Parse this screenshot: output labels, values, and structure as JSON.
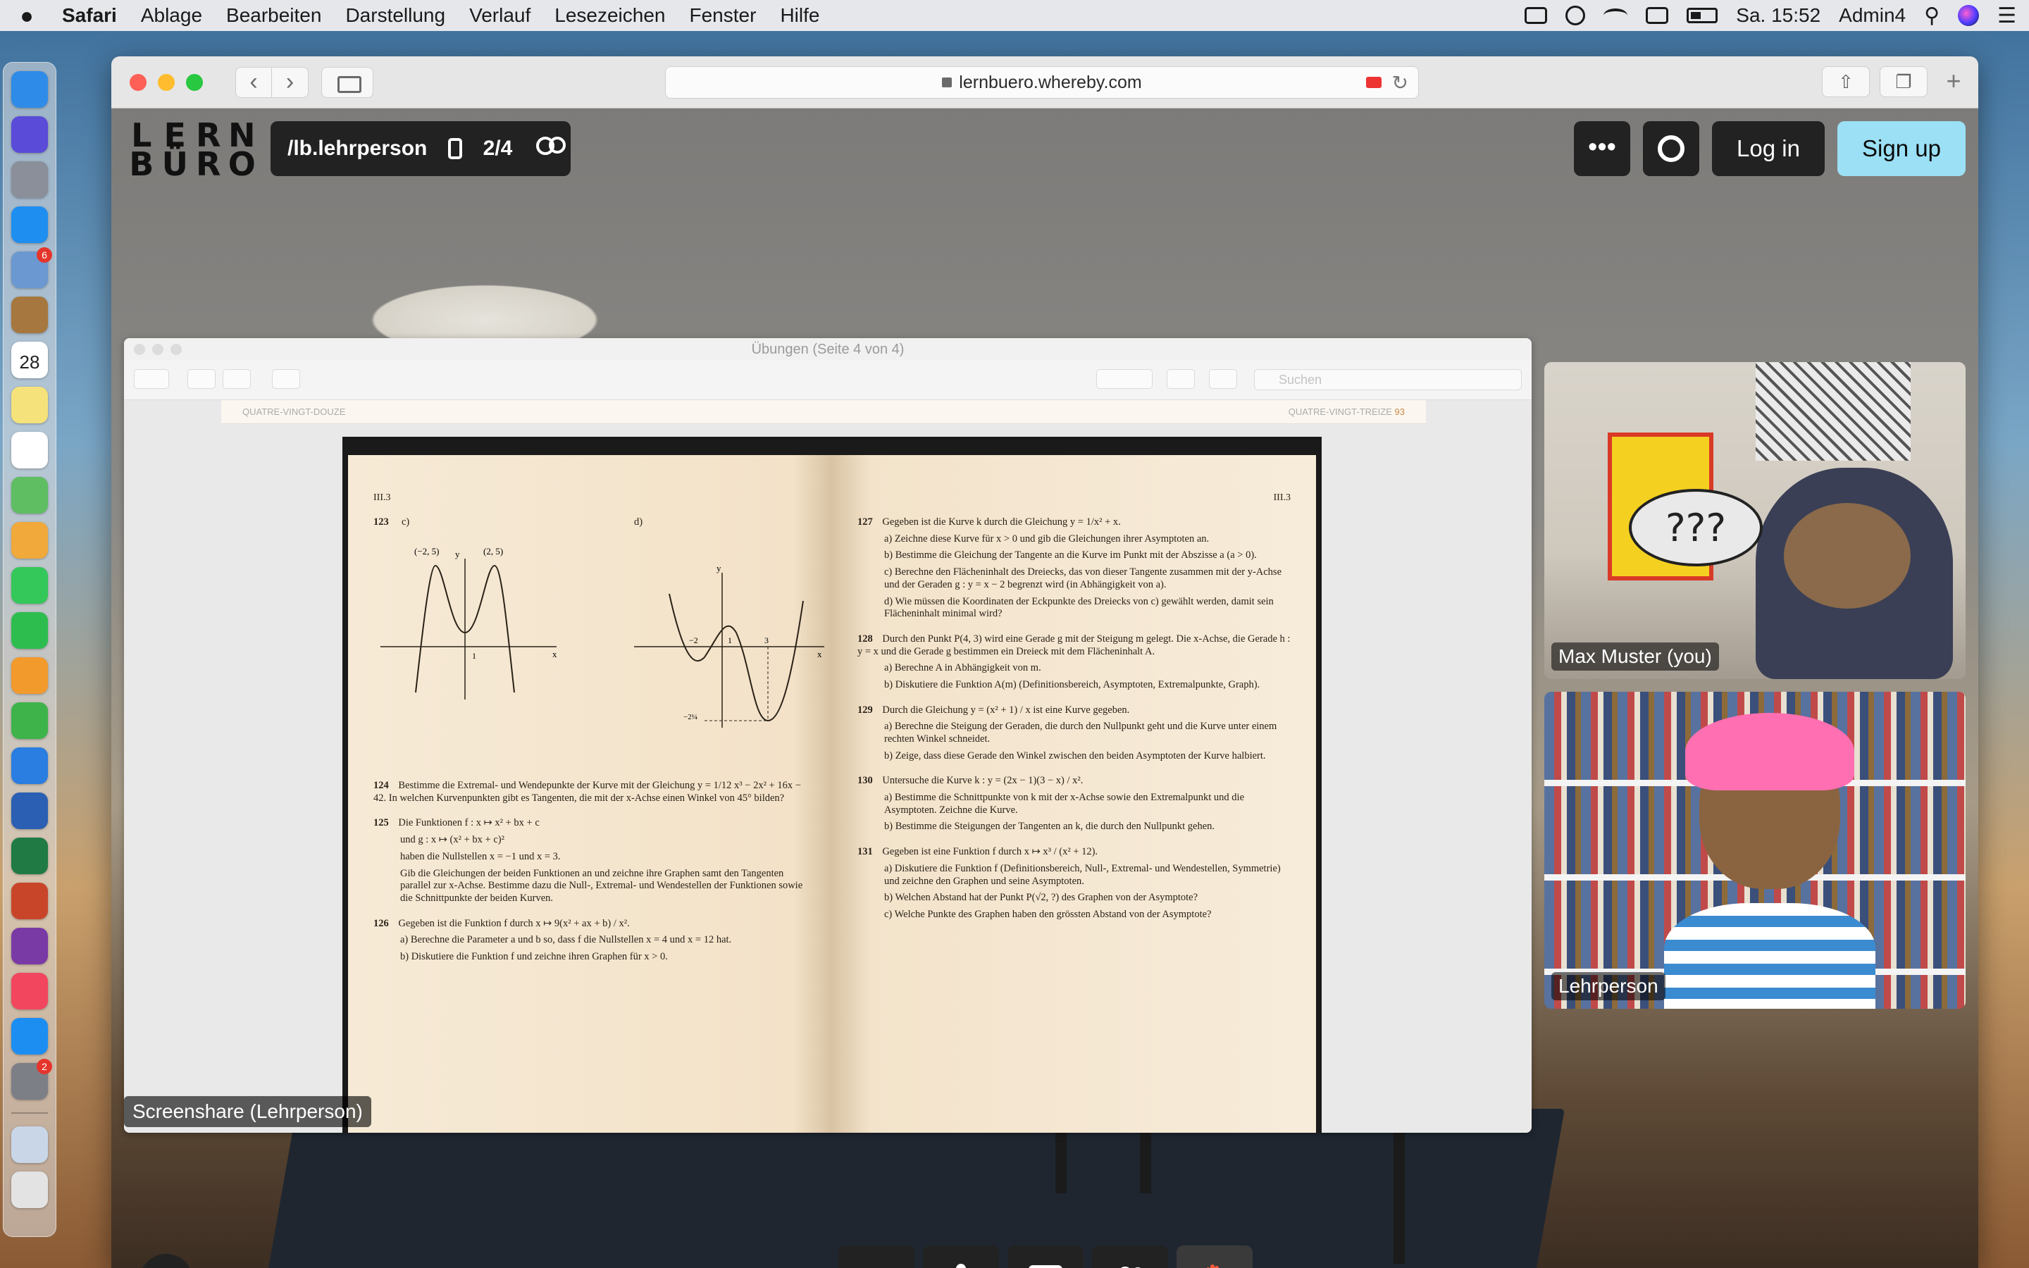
{
  "menubar": {
    "apple": "",
    "items": [
      "Safari",
      "Ablage",
      "Bearbeiten",
      "Darstellung",
      "Verlauf",
      "Lesezeichen",
      "Fenster",
      "Hilfe"
    ],
    "clock": "Sa. 15:52",
    "user": "Admin4"
  },
  "dock": {
    "apps": [
      {
        "icon": "finder-icon",
        "color": "#2e8ce8"
      },
      {
        "icon": "siri-icon",
        "color": "#5a4bd8"
      },
      {
        "icon": "launchpad-icon",
        "color": "#8b8f99"
      },
      {
        "icon": "safari-icon",
        "color": "#1e8ef0"
      },
      {
        "icon": "mail-icon",
        "color": "#6b98d0",
        "badge": "6"
      },
      {
        "icon": "notes-brown-icon",
        "color": "#a6773e"
      },
      {
        "icon": "calendar-icon",
        "color": "#ffffff",
        "text": "28"
      },
      {
        "icon": "notes-icon",
        "color": "#f5e27a"
      },
      {
        "icon": "reminders-icon",
        "color": "#ffffff"
      },
      {
        "icon": "maps-icon",
        "color": "#5fbd62"
      },
      {
        "icon": "photos-icon",
        "color": "#f0a93a"
      },
      {
        "icon": "messages-icon",
        "color": "#34c759"
      },
      {
        "icon": "facetime-icon",
        "color": "#2dbd4f"
      },
      {
        "icon": "pages-icon",
        "color": "#f29a2c"
      },
      {
        "icon": "numbers-icon",
        "color": "#3db34a"
      },
      {
        "icon": "keynote-icon",
        "color": "#2a7de1"
      },
      {
        "icon": "word-icon",
        "color": "#2b5fb3"
      },
      {
        "icon": "excel-icon",
        "color": "#1f7a44"
      },
      {
        "icon": "powerpoint-icon",
        "color": "#c9452a"
      },
      {
        "icon": "onenote-icon",
        "color": "#7a3aa6"
      },
      {
        "icon": "music-icon",
        "color": "#f2465e"
      },
      {
        "icon": "appstore-icon",
        "color": "#1c8ef2"
      },
      {
        "icon": "system-preferences-icon",
        "color": "#7d7f86",
        "badge": "2"
      },
      {
        "icon": "preview-icon",
        "color": "#c8d6e8"
      },
      {
        "icon": "trash-icon",
        "color": "#e3e3e3"
      }
    ]
  },
  "browser": {
    "url": "lernbuero.whereby.com"
  },
  "whereby": {
    "logo_letters": [
      "L",
      "E",
      "R",
      "N",
      "B",
      "Ü",
      "R",
      "O"
    ],
    "room_name": "/lb.lehrperson",
    "participant_count": "2/4",
    "more_label": "•••",
    "login_label": "Log in",
    "signup_label": "Sign up",
    "help_label": "?",
    "screenshare_label": "Screenshare (Lehrperson)",
    "participants": [
      {
        "name": "Max Muster (you)",
        "speech": "???"
      },
      {
        "name": "Lehrperson"
      }
    ]
  },
  "preview": {
    "title": "Übungen (Seite 4 von 4)",
    "search_placeholder": "Suchen",
    "prev_page_left": "QUATRE-VINGT-DOUZE",
    "prev_page_right": "QUATRE-VINGT-TREIZE",
    "prev_page_num": "93"
  },
  "book": {
    "left": {
      "section": "III.3",
      "p123": {
        "num": "123",
        "c": "c)",
        "d": "d)"
      },
      "graph_labels": {
        "max_left": "(−2, 5)",
        "max_right": "(2, 5)",
        "x": "x",
        "y": "y",
        "one": "1",
        "one_b": "1",
        "three": "3",
        "minus_two": "−2",
        "minus_frac": "−2¼"
      },
      "p124": {
        "num": "124",
        "text": "Bestimme die Extremal- und Wendepunkte der Kurve mit der Gleichung y = 1/12 x³ − 2x² + 16x − 42. In welchen Kurvenpunkten gibt es Tangenten, die mit der x-Achse einen Winkel von 45° bilden?"
      },
      "p125": {
        "num": "125",
        "line1": "Die Funktionen        f : x ↦ x² + bx + c",
        "line2": "und                         g : x ↦ (x² + bx + c)²",
        "line3": "haben die Nullstellen   x = −1 und x = 3.",
        "text": "Gib die Gleichungen der beiden Funktionen an und zeichne ihre Graphen samt den Tangenten parallel zur x-Achse. Bestimme dazu die Null-, Extremal- und Wendestellen der Funktionen sowie die Schnittpunkte der beiden Kurven."
      },
      "p126": {
        "num": "126",
        "text": "Gegeben ist die Funktion f durch x ↦ 9(x² + ax + b) / x².",
        "a": "a) Berechne die Parameter a und b so, dass f die Nullstellen x = 4 und x = 12 hat.",
        "b": "b) Diskutiere die Funktion f und zeichne ihren Graphen für x > 0."
      }
    },
    "right": {
      "section": "III.3",
      "p127": {
        "num": "127",
        "text": "Gegeben ist die Kurve k durch die Gleichung y = 1/x² + x.",
        "a": "a) Zeichne diese Kurve für x > 0 und gib die Gleichungen ihrer Asymptoten an.",
        "b": "b) Bestimme die Gleichung der Tangente an die Kurve im Punkt mit der Abszisse a (a > 0).",
        "c": "c) Berechne den Flächeninhalt des Dreiecks, das von dieser Tangente zusammen mit der y-Achse und der Geraden g : y = x − 2 begrenzt wird (in Abhängigkeit von a).",
        "d": "d) Wie müssen die Koordinaten der Eckpunkte des Dreiecks von c) gewählt werden, damit sein Flächeninhalt minimal wird?"
      },
      "p128": {
        "num": "128",
        "text": "Durch den Punkt P(4, 3) wird eine Gerade g mit der Steigung m gelegt. Die x-Achse, die Gerade h : y = x und die Gerade g bestimmen ein Dreieck mit dem Flächeninhalt A.",
        "a": "a) Berechne A in Abhängigkeit von m.",
        "b": "b) Diskutiere die Funktion A(m) (Definitionsbereich, Asymptoten, Extremalpunkte, Graph)."
      },
      "p129": {
        "num": "129",
        "text": "Durch die Gleichung y = (x² + 1) / x ist eine Kurve gegeben.",
        "a": "a) Berechne die Steigung der Geraden, die durch den Nullpunkt geht und die Kurve unter einem rechten Winkel schneidet.",
        "b": "b) Zeige, dass diese Gerade den Winkel zwischen den beiden Asymptoten der Kurve halbiert."
      },
      "p130": {
        "num": "130",
        "text": "Untersuche die Kurve k : y = (2x − 1)(3 − x) / x².",
        "a": "a) Bestimme die Schnittpunkte von k mit der x-Achse sowie den Extremalpunkt und die Asymptoten. Zeichne die Kurve.",
        "b": "b) Bestimme die Steigungen der Tangenten an k, die durch den Nullpunkt gehen."
      },
      "p131": {
        "num": "131",
        "text": "Gegeben ist eine Funktion f durch x ↦ x³ / (x² + 12).",
        "a": "a) Diskutiere die Funktion f (Definitionsbereich, Null-, Extremal- und Wendestellen, Symmetrie) und zeichne den Graphen und seine Asymptoten.",
        "b": "b) Welchen Abstand hat der Punkt P(√2, ?) des Graphen von der Asymptote?",
        "c": "c) Welche Punkte des Graphen haben den grössten Abstand von der Asymptote?"
      }
    }
  },
  "colors": {
    "accent_signup": "#9be0f5",
    "dark_button": "#222222",
    "hand_raise": "#ff5a36"
  }
}
